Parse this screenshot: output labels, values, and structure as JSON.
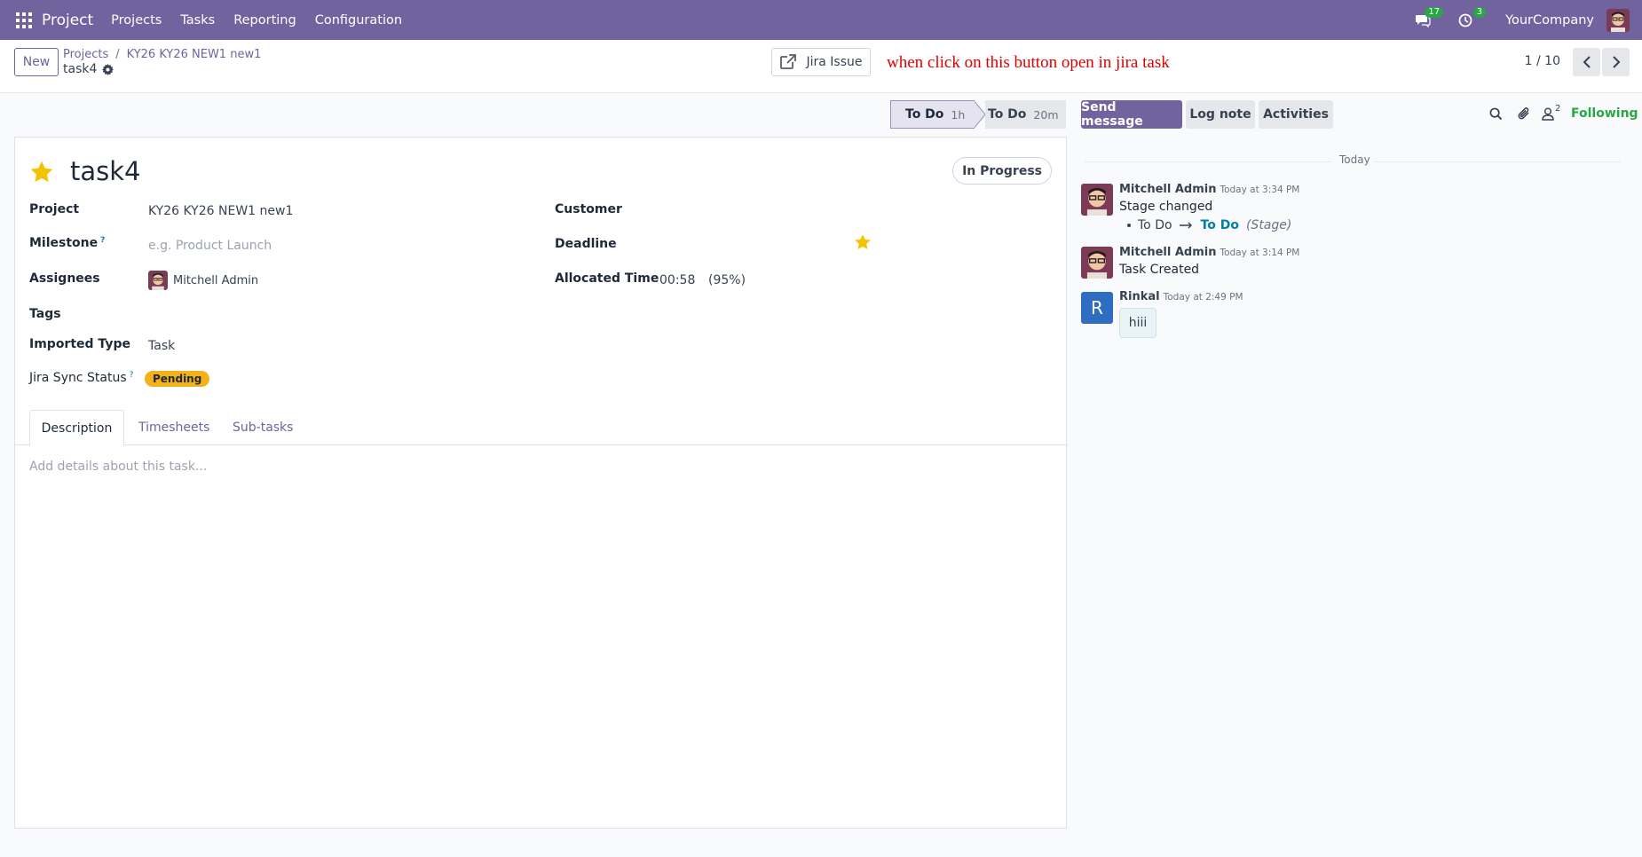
{
  "topnav": {
    "app_name": "Project",
    "menu": [
      "Projects",
      "Tasks",
      "Reporting",
      "Configuration"
    ],
    "messages_count": "17",
    "activities_count": "3",
    "company": "YourCompany",
    "icons": [
      "apps-grid-icon",
      "chat-icon",
      "clock-icon",
      "user-avatar"
    ]
  },
  "control": {
    "new_label": "New",
    "breadcrumb": [
      "Projects",
      "KY26 KY26 NEW1 new1"
    ],
    "record_name": "task4",
    "jira_button": "Jira Issue",
    "annotation": "when click on this button open in jira task",
    "pager": "1 / 10"
  },
  "stages": [
    {
      "label": "To Do",
      "duration": "1h"
    },
    {
      "label": "To Do",
      "duration": "20m"
    }
  ],
  "form": {
    "title": "task4",
    "status": "In Progress",
    "fields": {
      "project_label": "Project",
      "project_value": "KY26 KY26 NEW1 new1",
      "milestone_label": "Milestone",
      "milestone_placeholder": "e.g. Product Launch",
      "assignees_label": "Assignees",
      "assignees_value": "Mitchell Admin",
      "tags_label": "Tags",
      "imported_type_label": "Imported Type",
      "imported_type_value": "Task",
      "jira_sync_label": "Jira Sync Status",
      "jira_sync_value": "Pending",
      "customer_label": "Customer",
      "deadline_label": "Deadline",
      "allocated_label": "Allocated Time",
      "allocated_value": "00:58",
      "allocated_percent": "(95%)",
      "help_mark": "?"
    },
    "tabs": [
      "Description",
      "Timesheets",
      "Sub-tasks"
    ],
    "description_placeholder": "Add details about this task..."
  },
  "chatter": {
    "send_message": "Send message",
    "log_note": "Log note",
    "activities": "Activities",
    "followers_count": "2",
    "following": "Following",
    "date_separator": "Today",
    "messages": [
      {
        "author": "Mitchell Admin",
        "time": "Today at 3:34 PM",
        "body": "Stage changed",
        "tracking_old": "To Do",
        "tracking_new": "To Do",
        "tracking_field": "(Stage)"
      },
      {
        "author": "Mitchell Admin",
        "time": "Today at 3:14 PM",
        "body": "Task Created"
      },
      {
        "author": "Rinkal",
        "initial": "R",
        "time": "Today at 2:49 PM",
        "body": "hiii"
      }
    ]
  },
  "colors": {
    "brand": "#71639e",
    "success": "#28a745",
    "pending_badge": "#f3b21b",
    "star": "#f3c200",
    "annotation_red": "#e00000"
  }
}
